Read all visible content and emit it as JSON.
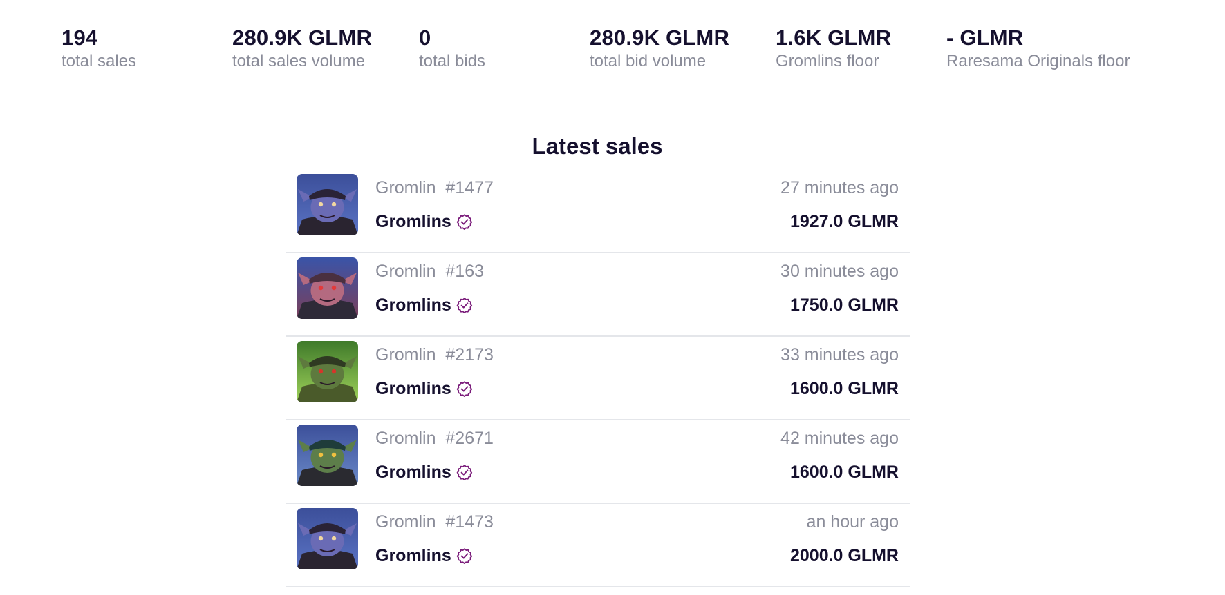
{
  "stats": [
    {
      "value": "194",
      "label": "total sales"
    },
    {
      "value": "280.9K GLMR",
      "label": "total sales volume"
    },
    {
      "value": "0",
      "label": "total bids"
    },
    {
      "value": "280.9K GLMR",
      "label": "total bid volume"
    },
    {
      "value": "1.6K GLMR",
      "label": "Gromlins floor"
    },
    {
      "value": "- GLMR",
      "label": "Raresama Originals floor"
    }
  ],
  "latest_sales": {
    "title": "Latest sales",
    "items": [
      {
        "name": "Gromlin  #1477",
        "collection": "Gromlins",
        "time": "27 minutes ago",
        "price": "1927.0 GLMR",
        "thumb_icon": "gromlin-avatar-purple-cap"
      },
      {
        "name": "Gromlin  #163",
        "collection": "Gromlins",
        "time": "30 minutes ago",
        "price": "1750.0 GLMR",
        "thumb_icon": "gromlin-avatar-pink"
      },
      {
        "name": "Gromlin  #2173",
        "collection": "Gromlins",
        "time": "33 minutes ago",
        "price": "1600.0 GLMR",
        "thumb_icon": "gromlin-avatar-green"
      },
      {
        "name": "Gromlin  #2671",
        "collection": "Gromlins",
        "time": "42 minutes ago",
        "price": "1600.0 GLMR",
        "thumb_icon": "gromlin-avatar-green-cap"
      },
      {
        "name": "Gromlin  #1473",
        "collection": "Gromlins",
        "time": "an hour ago",
        "price": "2000.0 GLMR",
        "thumb_icon": "gromlin-avatar-purple-cap"
      }
    ]
  },
  "colors": {
    "text_primary": "#15102e",
    "text_secondary": "#8a8c99",
    "verified_badge": "#7a1b7a",
    "divider": "#e4e6ea"
  }
}
